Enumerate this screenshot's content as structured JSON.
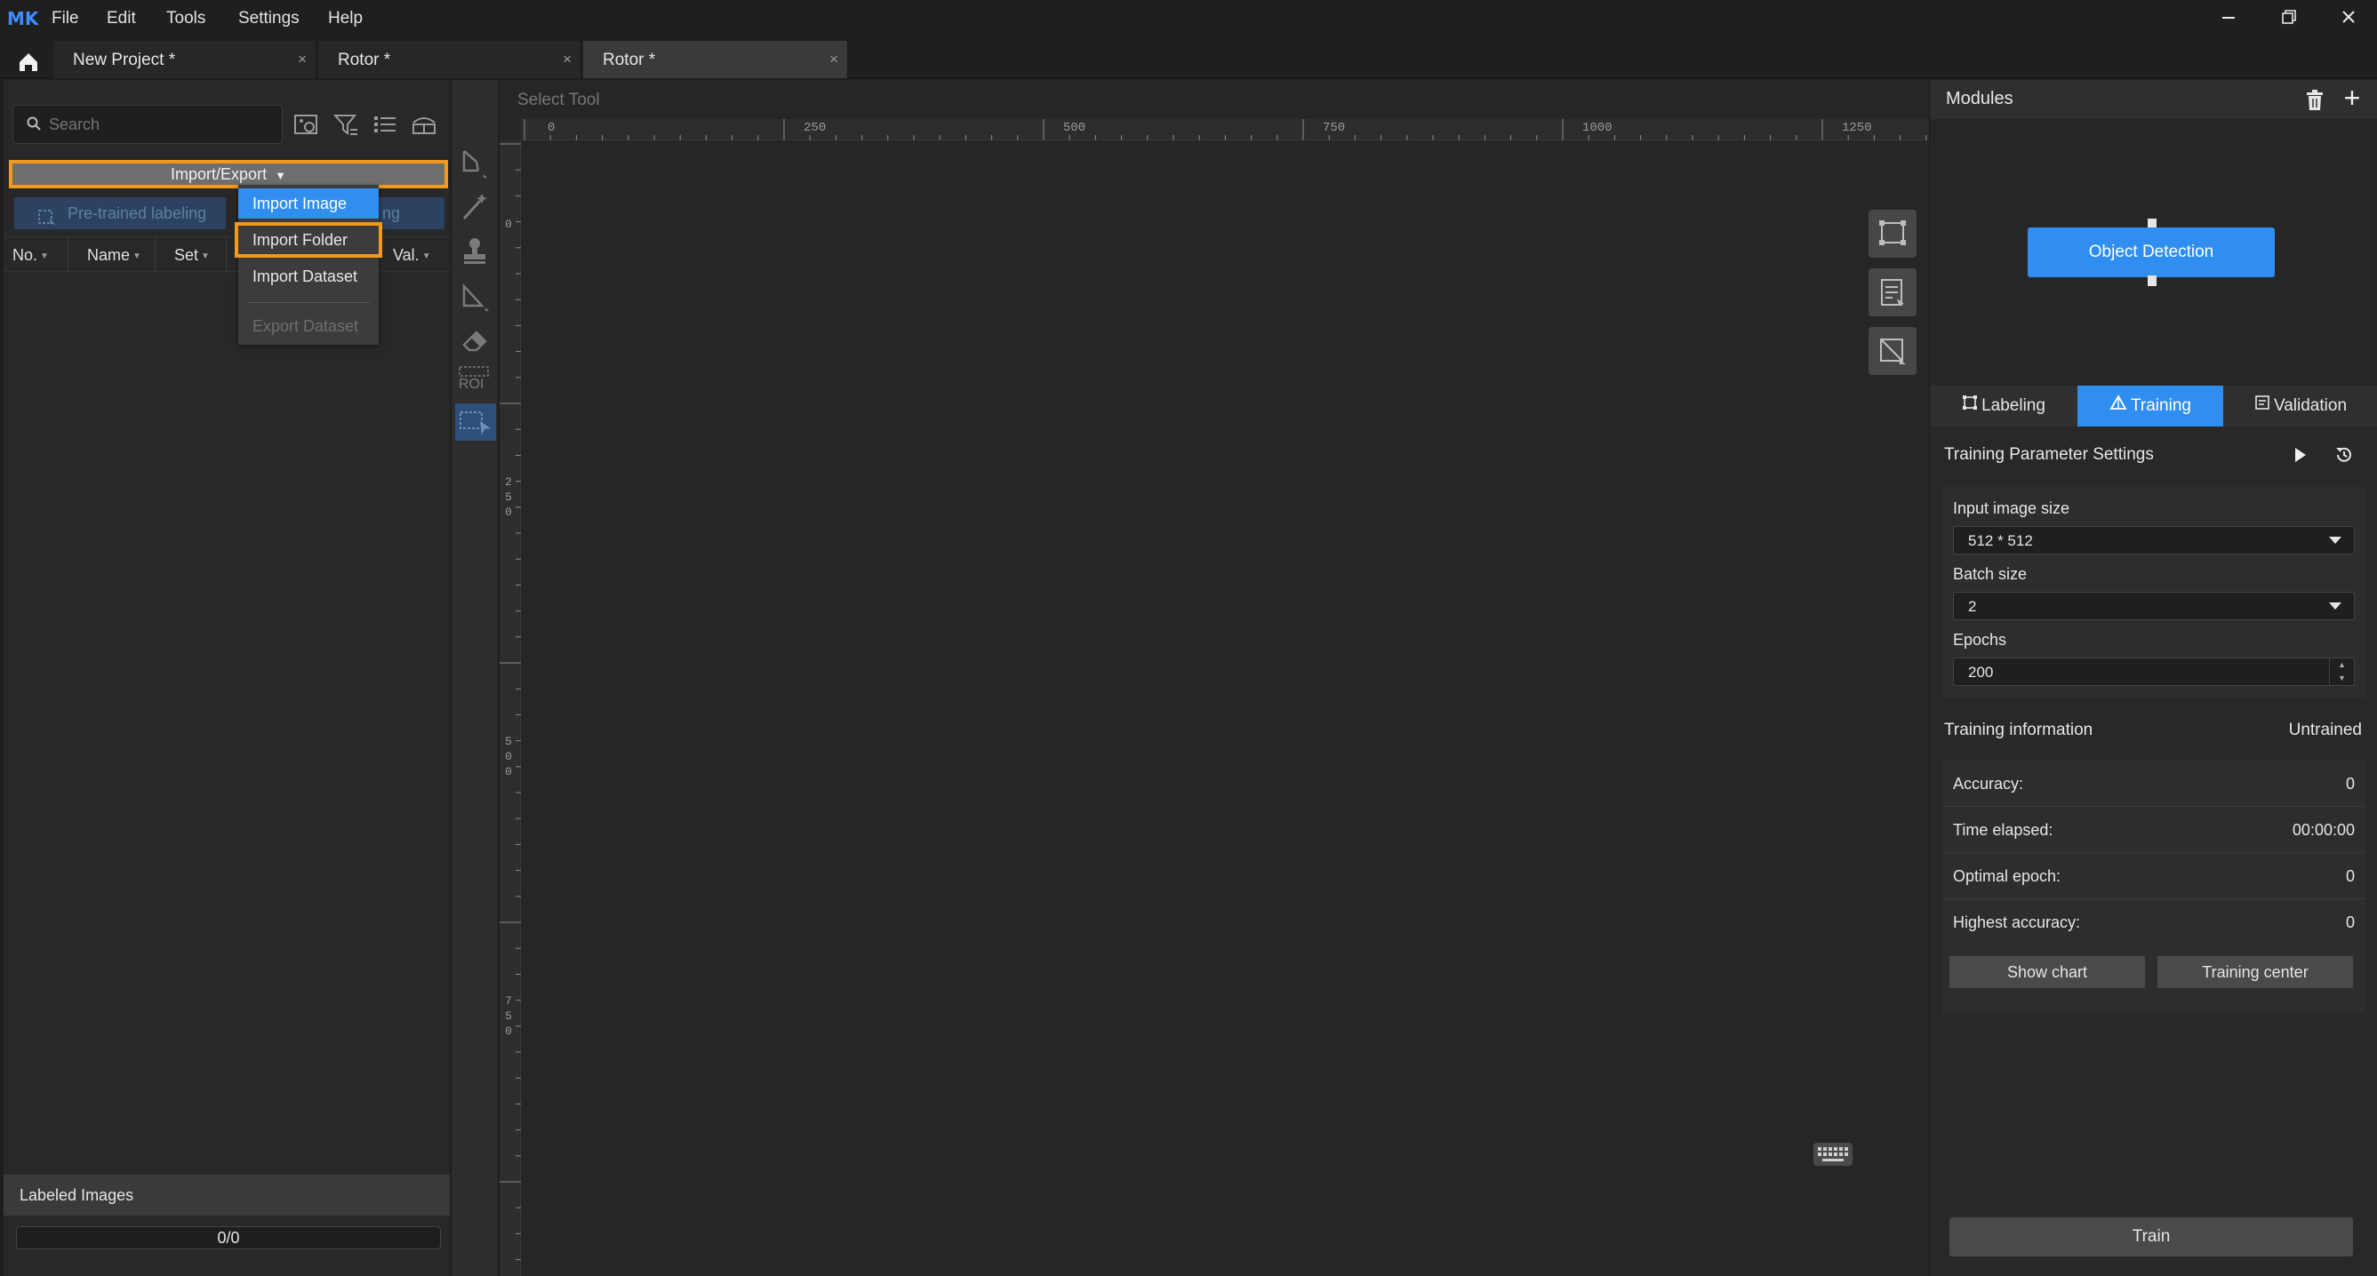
{
  "app": {
    "logo_text": "MK",
    "menu": [
      "File",
      "Edit",
      "Tools",
      "Settings",
      "Help"
    ]
  },
  "tabs": [
    {
      "label": "New Project *"
    },
    {
      "label": "Rotor *"
    },
    {
      "label": "Rotor *"
    }
  ],
  "left_panel": {
    "search_placeholder": "Search",
    "import_export_label": "Import/Export",
    "pretrained_label": "Pre-trained labeling",
    "second_button_partial": "ng",
    "columns": [
      {
        "label": "No."
      },
      {
        "label": "Name"
      },
      {
        "label": "Set"
      },
      {
        "label": "Val."
      }
    ],
    "labeled_images_label": "Labeled Images",
    "progress_text": "0/0"
  },
  "dropdown": {
    "import_image": "Import Image",
    "import_folder": "Import Folder",
    "import_dataset": "Import Dataset",
    "export_dataset": "Export Dataset"
  },
  "toolbar": {
    "roi_label": "ROI"
  },
  "canvas": {
    "tool_label": "Select Tool",
    "top_ruler": [
      "0",
      "250",
      "500",
      "750",
      "1000",
      "1250"
    ],
    "left_ruler": [
      "0",
      "250",
      "500",
      "750"
    ]
  },
  "right_panel": {
    "modules_title": "Modules",
    "module_node": "Object Detection",
    "mode_tabs": [
      "Labeling",
      "Training",
      "Validation"
    ],
    "params_title": "Training Parameter Settings",
    "params": {
      "input_size_label": "Input image size",
      "input_size_value": "512 * 512",
      "batch_label": "Batch size",
      "batch_value": "2",
      "epochs_label": "Epochs",
      "epochs_value": "200"
    },
    "info_title": "Training information",
    "info_status": "Untrained",
    "info": {
      "accuracy_label": "Accuracy:",
      "accuracy_value": "0",
      "time_label": "Time elapsed:",
      "time_value": "00:00:00",
      "optimal_label": "Optimal epoch:",
      "optimal_value": "0",
      "highest_label": "Highest accuracy:",
      "highest_value": "0"
    },
    "show_chart": "Show chart",
    "training_center": "Training center",
    "train": "Train"
  }
}
